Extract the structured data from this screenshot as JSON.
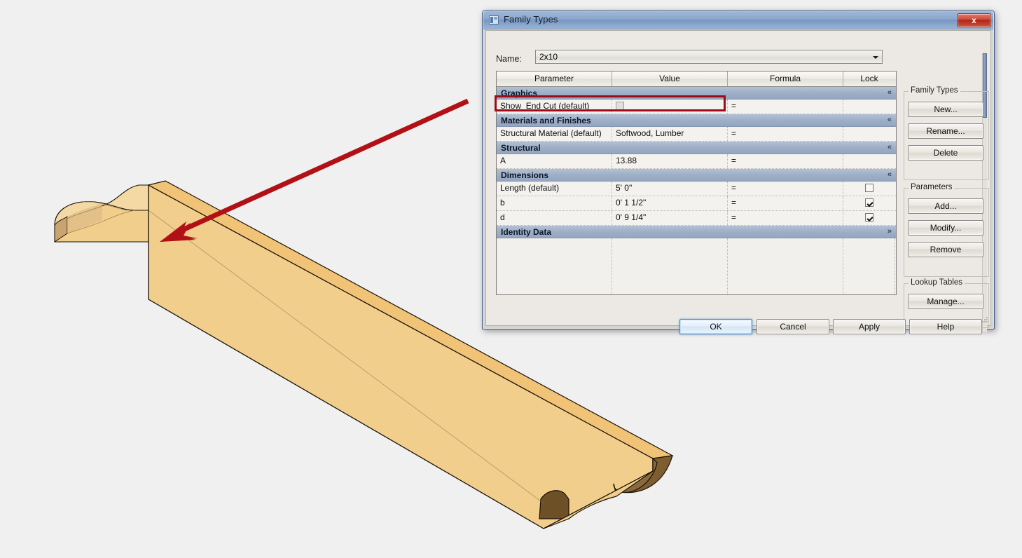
{
  "window": {
    "title": "Family Types",
    "icon": "family-types-icon",
    "close_label": "x"
  },
  "name_field": {
    "label": "Name:",
    "value": "2x10",
    "dropdown_icon": "chevron-down-icon"
  },
  "table": {
    "columns": [
      "Parameter",
      "Value",
      "Formula",
      "Lock"
    ],
    "sections": [
      {
        "title": "Graphics",
        "collapse_icon": "«",
        "rows": [
          {
            "parameter": "Show_End Cut (default)",
            "value": "",
            "value_type": "checkbox",
            "value_checked": false,
            "value_disabled": true,
            "formula": "=",
            "lock": "none",
            "highlighted": true
          }
        ]
      },
      {
        "title": "Materials and Finishes",
        "collapse_icon": "«",
        "rows": [
          {
            "parameter": "Structural Material (default)",
            "value": "Softwood, Lumber",
            "value_type": "text",
            "formula": "=",
            "lock": "none",
            "highlighted": false
          }
        ]
      },
      {
        "title": "Structural",
        "collapse_icon": "«",
        "rows": [
          {
            "parameter": "A",
            "value": "13.88",
            "value_type": "text",
            "formula": "=",
            "lock": "none",
            "highlighted": false
          }
        ]
      },
      {
        "title": "Dimensions",
        "collapse_icon": "«",
        "rows": [
          {
            "parameter": "Length (default)",
            "value": "5'  0\"",
            "value_type": "text",
            "formula": "=",
            "lock": "unchecked",
            "highlighted": false
          },
          {
            "parameter": "b",
            "value": "0'  1 1/2\"",
            "value_type": "text",
            "formula": "=",
            "lock": "checked",
            "highlighted": false
          },
          {
            "parameter": "d",
            "value": "0'  9 1/4\"",
            "value_type": "text",
            "formula": "=",
            "lock": "checked",
            "highlighted": false
          }
        ]
      },
      {
        "title": "Identity Data",
        "collapse_icon": "»",
        "rows": []
      }
    ]
  },
  "side_panel": {
    "groups": [
      {
        "title": "Family Types",
        "buttons": [
          "New...",
          "Rename...",
          "Delete"
        ]
      },
      {
        "title": "Parameters",
        "buttons": [
          "Add...",
          "Modify...",
          "Remove"
        ]
      },
      {
        "title": "Lookup Tables",
        "buttons": [
          "Manage..."
        ]
      }
    ]
  },
  "footer": {
    "ok": "OK",
    "cancel": "Cancel",
    "apply": "Apply",
    "help": "Help"
  },
  "annotation": {
    "type": "arrow",
    "color": "#b11116",
    "description": "red arrow pointing from dialog toward beam end cut face"
  },
  "model": {
    "description": "3D isometric view of a wooden 2x10 beam with a shaped/profiled underside",
    "colors": {
      "face_front": "#f2ce8c",
      "face_top": "#f0c377",
      "face_end": "#8a6a3c",
      "shadow": "#d6b37e",
      "outline": "#1a1208",
      "background": "#f0f0f0"
    }
  }
}
